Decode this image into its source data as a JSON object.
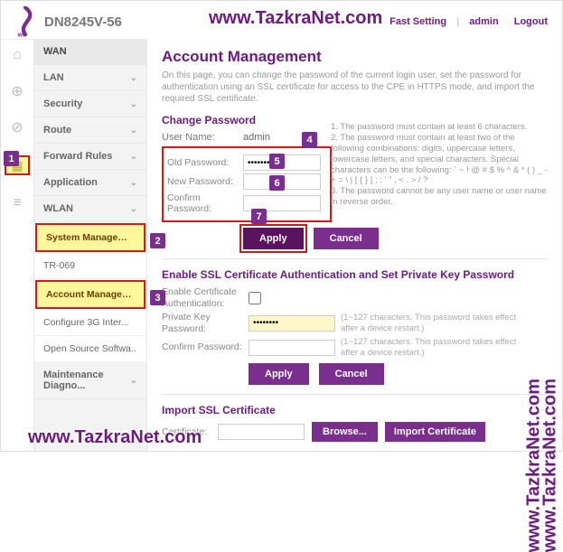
{
  "header": {
    "model": "DN8245V-56",
    "fast_setting": "Fast Setting",
    "admin": "admin",
    "logout": "Logout"
  },
  "rail": {
    "home": "⌂",
    "wifi": "⊕",
    "globe": "⊘",
    "selected": "▦",
    "tools": "≡"
  },
  "sidebar": {
    "wan": "WAN",
    "lan": "LAN",
    "security": "Security",
    "route": "Route",
    "forward": "Forward Rules",
    "application": "Application",
    "wlan": "WLAN",
    "sys_mgmt": "System Management",
    "tr069": "TR-069",
    "acct_mgmt": "Account Management",
    "cfg3g": "Configure 3G Inter...",
    "oss": "Open Source Softwa..",
    "maint": "Maintenance Diagno..."
  },
  "page": {
    "title": "Account Management",
    "desc": "On this page, you can change the password of the current login user, set the password for authentication using an SSL certificate for access to the CPE in HTTPS mode, and import the required SSL certificate.",
    "change_pw": "Change Password",
    "user_name_label": "User Name:",
    "user_name_value": "admin",
    "old_pw": "Old Password:",
    "old_pw_value": "••••••••",
    "new_pw": "New Password:",
    "confirm_pw": "Confirm Password:",
    "rules": "1. The password must contain at least 6 characters.\n2. The password must contain at least two of the following combinations: digits, uppercase letters, lowercase letters, and special characters. Special characters can be the following: ` ~ ! @ # $ % ^ & * ( ) _ - + = \\ | [ { } ] ; : ' \" , < . > / ?\n3. The password cannot be any user name or user name in reverse order.",
    "apply": "Apply",
    "cancel": "Cancel",
    "ssl_title": "Enable SSL Certificate Authentication and Set Private Key Password",
    "enable_cert": "Enable Certificate Authentication:",
    "priv_key": "Private Key Password:",
    "priv_key_value": "••••••••",
    "confirm_pw2": "Confirm Password:",
    "hint": "(1~127 characters. This password takes effect after a device restart.)",
    "import_title": "Import SSL Certificate",
    "cert_label": "Certificate:",
    "browse": "Browse...",
    "import_cert": "Import Certificate"
  },
  "anno": {
    "n1": "1",
    "n2": "2",
    "n3": "3",
    "n4": "4",
    "n5": "5",
    "n6": "6",
    "n7": "7"
  },
  "watermark": "www.TazkraNet.com"
}
